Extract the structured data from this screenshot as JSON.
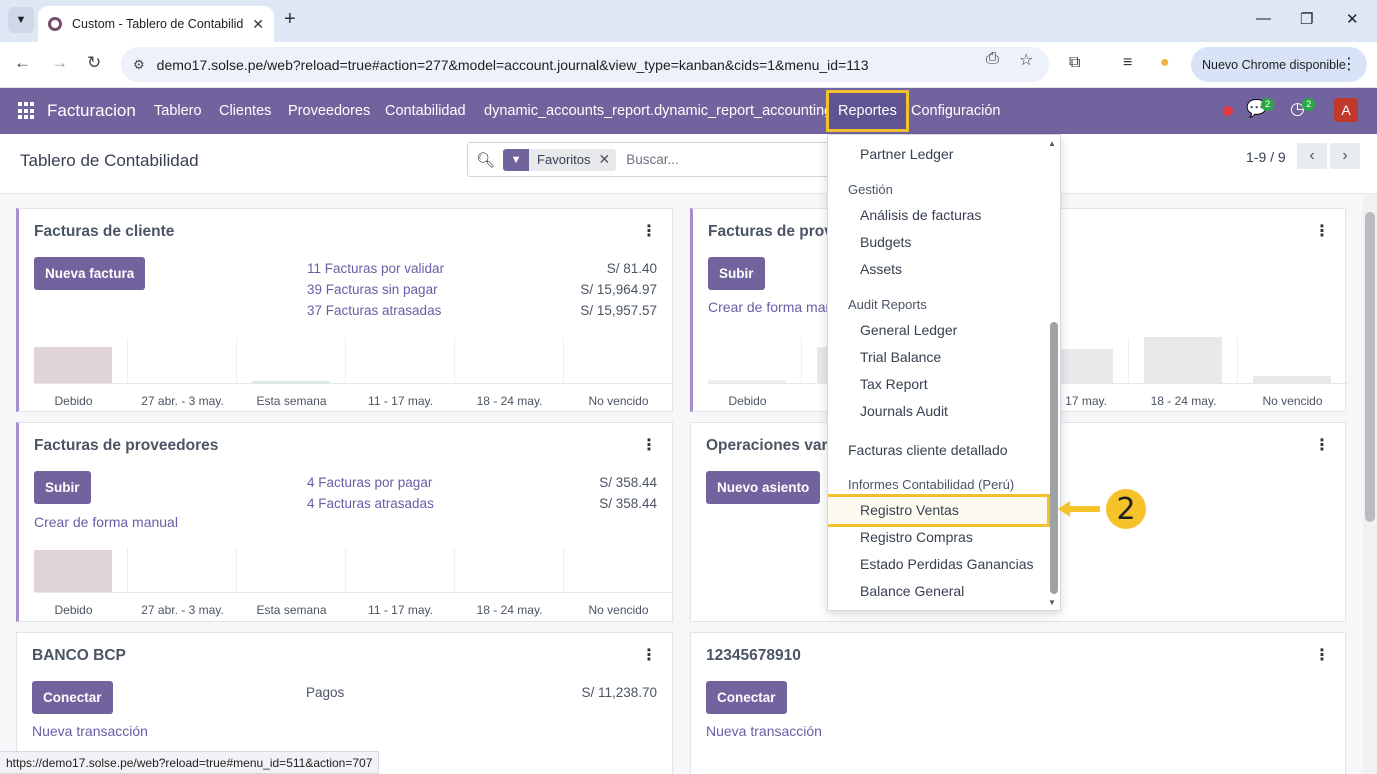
{
  "browser": {
    "tab_title": "Custom - Tablero de Contabilid",
    "url": "demo17.solse.pe/web?reload=true#action=277&model=account.journal&view_type=kanban&cids=1&menu_id=113",
    "update_label": "Nuevo Chrome disponible",
    "status_url": "https://demo17.solse.pe/web?reload=true#menu_id=511&action=707"
  },
  "navbar": {
    "brand": "Facturacion",
    "menu": [
      "Tablero",
      "Clientes",
      "Proveedores",
      "Contabilidad",
      "dynamic_accounts_report.dynamic_report_accounting",
      "Reportes",
      "Configuración"
    ],
    "chat_badge": "2",
    "activity_badge": "2",
    "avatar_letter": "A"
  },
  "control": {
    "title": "Tablero de Contabilidad",
    "facet": "Favoritos",
    "search_placeholder": "Buscar...",
    "pager": "1-9 / 9"
  },
  "graph_labels": [
    "Debido",
    "27 abr. - 3 may.",
    "Esta semana",
    "11 - 17 may.",
    "18 - 24 may.",
    "No vencido"
  ],
  "cards": {
    "sale": {
      "title": "Facturas de cliente",
      "button": "Nueva factura",
      "lines": [
        {
          "label": "11 Facturas por validar",
          "value": "S/ 81.40"
        },
        {
          "label": "39 Facturas sin pagar",
          "value": "S/ 15,964.97"
        },
        {
          "label": "37 Facturas atrasadas",
          "value": "S/ 15,957.57"
        }
      ]
    },
    "purchase_right": {
      "title": "Facturas de prov",
      "button": "Subir",
      "link": "Crear de forma manu"
    },
    "purchase": {
      "title": "Facturas de proveedores",
      "button": "Subir",
      "link": "Crear de forma manual",
      "lines": [
        {
          "label": "4 Facturas por pagar",
          "value": "S/ 358.44"
        },
        {
          "label": "4 Facturas atrasadas",
          "value": "S/ 358.44"
        }
      ]
    },
    "misc": {
      "title": "Operaciones vari",
      "button": "Nuevo asiento"
    },
    "bank": {
      "title": "BANCO BCP",
      "button": "Conectar",
      "link": "Nueva transacción",
      "lines": [
        {
          "label": "Pagos",
          "value": "S/ 11,238.70"
        }
      ]
    },
    "bank2": {
      "title": "12345678910",
      "button": "Conectar",
      "link": "Nueva transacción"
    }
  },
  "dropdown": {
    "partner_ledger": "Partner Ledger",
    "gestion_header": "Gestión",
    "gestion_items": [
      "Análisis de facturas",
      "Budgets",
      "Assets"
    ],
    "audit_header": "Audit Reports",
    "audit_items": [
      "General Ledger",
      "Trial Balance",
      "Tax Report",
      "Journals Audit"
    ],
    "facturas_detallado": "Facturas cliente detallado",
    "peru_header": "Informes Contabilidad (Perú)",
    "peru_items": [
      "Registro Ventas",
      "Registro Compras",
      "Estado Perdidas Ganancias",
      "Balance General"
    ]
  },
  "annotation": {
    "step": "2"
  },
  "colors": {
    "navbar": "#71639e",
    "highlight": "#f2c12e",
    "primary": "#71639e"
  }
}
